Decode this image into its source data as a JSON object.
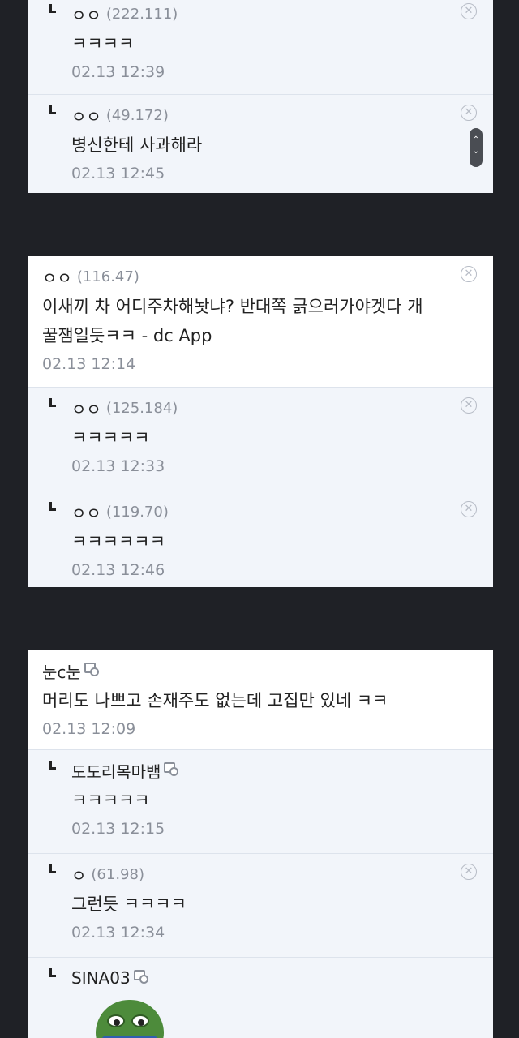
{
  "threads": [
    {
      "replies": [
        {
          "nick": "ㅇㅇ",
          "ip": "(222.111)",
          "text": "ㅋㅋㅋㅋ",
          "date": "02.13 12:39"
        },
        {
          "nick": "ㅇㅇ",
          "ip": "(49.172)",
          "text": "병신한테 사과해라",
          "date": "02.13 12:45"
        }
      ]
    },
    {
      "comment": {
        "nick": "ㅇㅇ",
        "ip": "(116.47)",
        "text_line1": "이새끼 차 어디주차해놧냐? 반대쪽 긁으러가야겟다 개",
        "text_line2": "꿀잼일듯ㅋㅋ - dc App",
        "date": "02.13 12:14"
      },
      "replies": [
        {
          "nick": "ㅇㅇ",
          "ip": "(125.184)",
          "text": "ㅋㅋㅋㅋㅋ",
          "date": "02.13 12:33"
        },
        {
          "nick": "ㅇㅇ",
          "ip": "(119.70)",
          "text": "ㅋㅋㅋㅋㅋㅋ",
          "date": "02.13 12:46"
        }
      ]
    },
    {
      "comment": {
        "nick": "눈c눈",
        "text": "머리도 나쁘고 손재주도 없는데 고집만 있네 ㅋㅋ",
        "date": "02.13 12:09"
      },
      "replies": [
        {
          "nick": "도도리목마뱀",
          "text": "ㅋㅋㅋㅋㅋ",
          "date": "02.13 12:15"
        },
        {
          "nick": "ㅇ",
          "ip": "(61.98)",
          "text": "그런듯 ㅋㅋㅋㅋ",
          "date": "02.13 12:34"
        },
        {
          "nick": "SINA03"
        }
      ]
    }
  ],
  "icons": {
    "delete": "close-circle-icon",
    "gallog": "gallog-icon",
    "reply": "reply-arrow-icon"
  },
  "colors": {
    "background": "#1f2126",
    "reply_bg": "#f2f5fa",
    "comment_bg": "#ffffff",
    "meta_text": "#8a8f99"
  }
}
